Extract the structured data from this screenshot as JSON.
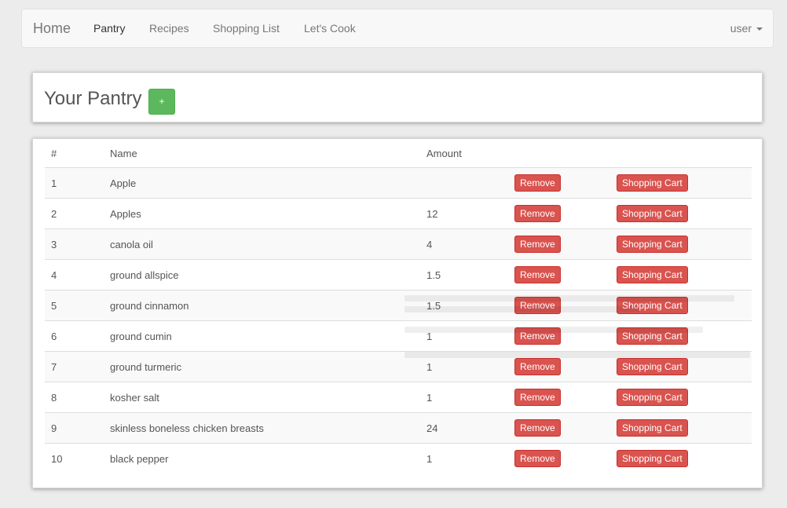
{
  "navbar": {
    "brand": "Home",
    "links": [
      {
        "label": "Pantry",
        "active": true
      },
      {
        "label": "Recipes",
        "active": false
      },
      {
        "label": "Shopping List",
        "active": false
      },
      {
        "label": "Let's Cook",
        "active": false
      }
    ],
    "user_menu": "user"
  },
  "header": {
    "title": "Your Pantry",
    "add_label": "+"
  },
  "table": {
    "columns": [
      "#",
      "Name",
      "Amount",
      "",
      ""
    ],
    "remove_label": "Remove",
    "cart_label": "Shopping Cart",
    "rows": [
      {
        "num": "1",
        "name": "Apple",
        "amount": ""
      },
      {
        "num": "2",
        "name": "Apples",
        "amount": "12"
      },
      {
        "num": "3",
        "name": "canola oil",
        "amount": "4"
      },
      {
        "num": "4",
        "name": "ground allspice",
        "amount": "1.5"
      },
      {
        "num": "5",
        "name": "ground cinnamon",
        "amount": "1.5"
      },
      {
        "num": "6",
        "name": "ground cumin",
        "amount": "1"
      },
      {
        "num": "7",
        "name": "ground turmeric",
        "amount": "1"
      },
      {
        "num": "8",
        "name": "kosher salt",
        "amount": "1"
      },
      {
        "num": "9",
        "name": "skinless boneless chicken breasts",
        "amount": "24"
      },
      {
        "num": "10",
        "name": "black pepper",
        "amount": "1"
      }
    ]
  },
  "colors": {
    "success": "#5cb85c",
    "danger": "#d9534f",
    "navbar_bg": "#f8f8f8",
    "page_bg": "#ececec"
  }
}
